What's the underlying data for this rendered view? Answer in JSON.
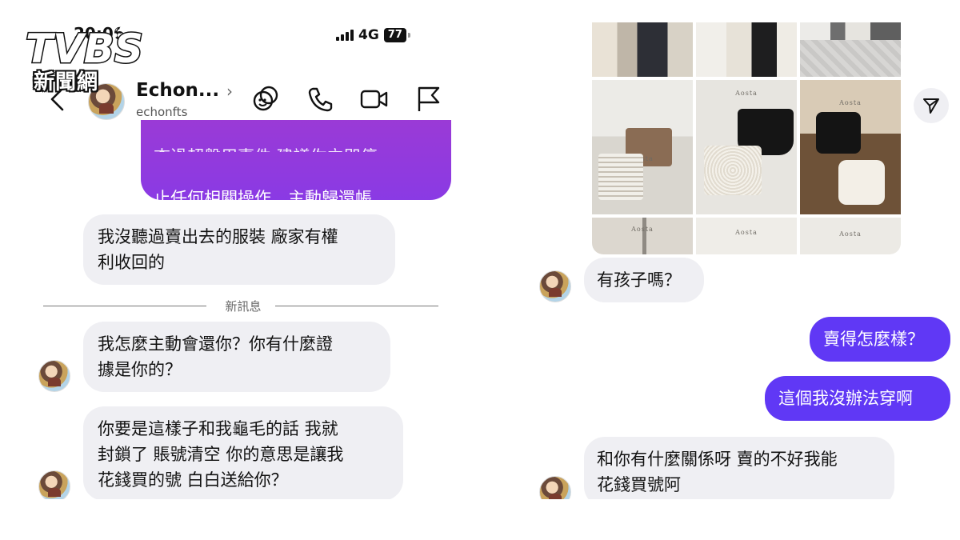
{
  "watermark": {
    "logo_text": "TVBS",
    "subtitle": "新聞網"
  },
  "status_bar": {
    "time": "20:06",
    "network": "4G",
    "battery": "77"
  },
  "header": {
    "name": "Echon...",
    "handle": "echonfts"
  },
  "left_messages": {
    "outgoing_top": "止任何相關操作，主動歸還帳\n號，否則將承擔全部後果。",
    "incoming_1": "我沒聽過賣出去的服裝 廠家有權\n利收回的",
    "divider": "新訊息",
    "incoming_2": "我怎麼主動會還你？你有什麼證\n據是你的？",
    "incoming_3": "你要是這樣子和我龜毛的話 我就\n封鎖了 賬號清空 你的意思是讓我\n花錢買的號 白白送給你？"
  },
  "photo_grid": {
    "brand_label": "Aosta"
  },
  "right_messages": {
    "incoming_1": "有孩子嗎？",
    "outgoing_1": "賣得怎麼樣？",
    "outgoing_2": "這個我沒辦法穿啊",
    "incoming_2": "和你有什麼關係呀 賣的不好我能\n花錢買號阿"
  },
  "colors": {
    "outgoing_bubble": "#7b39e8",
    "outgoing_bubble_right": "#6038f5",
    "incoming_bubble": "#efeff3"
  }
}
